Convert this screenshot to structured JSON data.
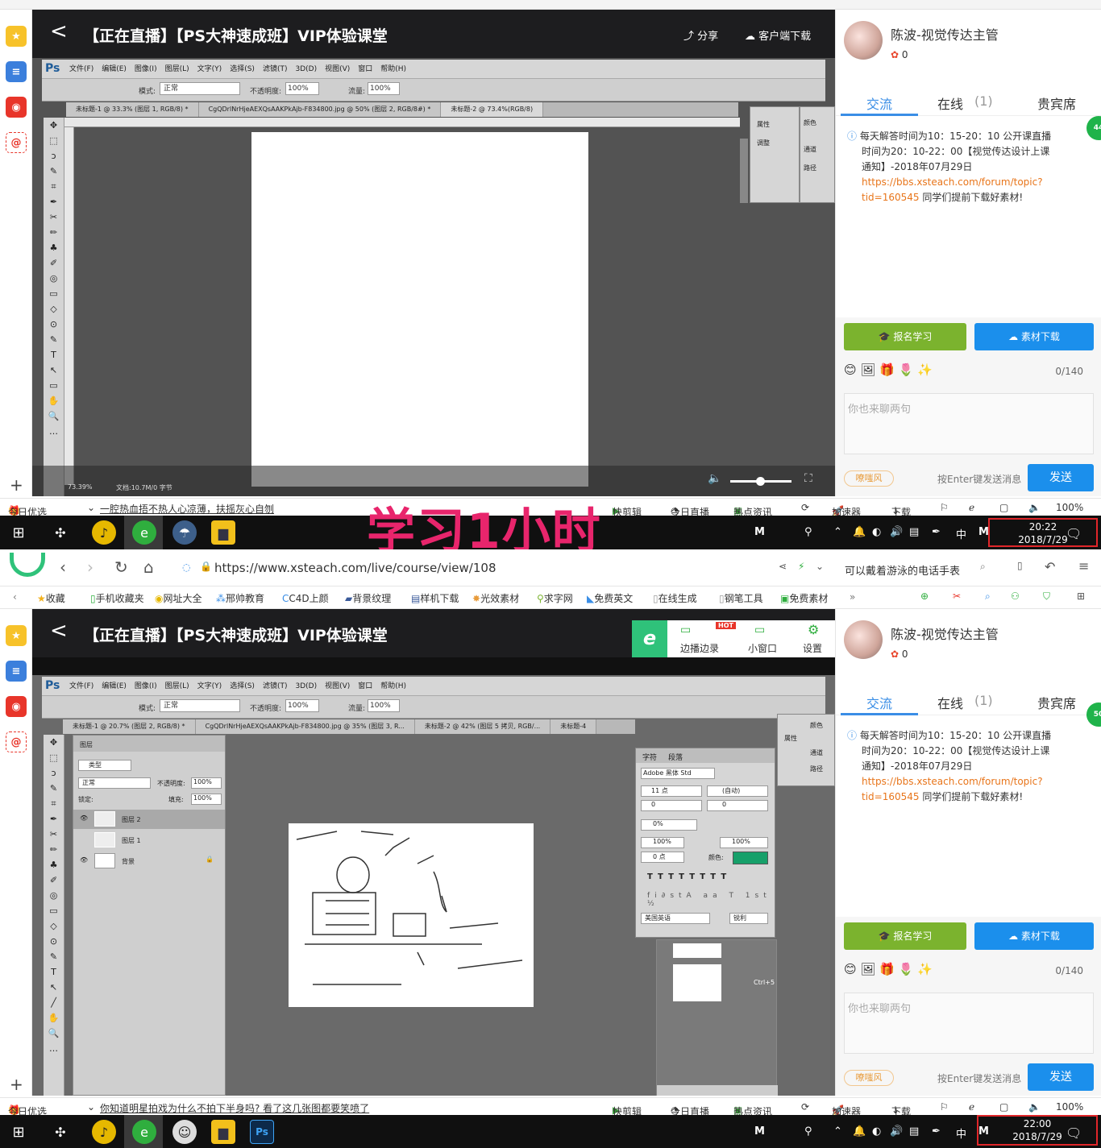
{
  "top": {
    "header": {
      "back": "<",
      "title": "【正在直播】【PS大神速成班】VIP体验课堂",
      "share": "分享",
      "download_client": "客户端下载"
    },
    "ps": {
      "logo": "Ps",
      "menu": [
        "文件(F)",
        "编辑(E)",
        "图像(I)",
        "图层(L)",
        "文字(Y)",
        "选择(S)",
        "滤镜(T)",
        "3D(D)",
        "视图(V)",
        "窗口",
        "帮助(H)"
      ],
      "options": {
        "mode_label": "模式:",
        "mode_value": "正常",
        "opacity_label": "不透明度:",
        "opacity_value": "100%",
        "flow_label": "流量:",
        "flow_value": "100%"
      },
      "tabs": [
        "未标题-1 @ 33.3% (图层 1, RGB/8) *",
        "CgQDrlNrHjeAEXQsAAKPkAjb-F834800.jpg @ 50% (图层 2, RGB/8#) *",
        "未标题-2 @ 73.4%(RGB/8)"
      ],
      "panels": [
        "属性",
        "调整",
        "颜色",
        "通道",
        "路径"
      ],
      "status_zoom": "73.39%",
      "status_doc": "文档:10.7M/0 字节"
    },
    "sidebar": {
      "user": "陈波-视觉传达主管",
      "likes": "0",
      "tabs": [
        "交流",
        "在线",
        "(1)",
        "贵宾席"
      ],
      "notice": {
        "line1": "每天解答时间为10：15-20：10 公开课直播",
        "line2": "时间为20：10-22：00【视觉传达设计上课",
        "line3": "通知】-2018年07月29日",
        "link1": "https://bbs.xsteach.com/forum/topic?",
        "link2": "tid=160545",
        "after": " 同学们提前下载好素材!"
      },
      "enroll": "报名学习",
      "material": "素材下载",
      "counter": "0/140",
      "placeholder": "你也来聊两句",
      "hint": "按Enter键发送消息",
      "send": "发送",
      "badge": "44",
      "tag": "嘹嗤风"
    },
    "strip": {
      "today": "今日优选",
      "news": "一腔热血捂不热人心凉薄，扶摇灰心自刎",
      "kuaijian": "快剪辑",
      "live": "今日直播",
      "hot": "热点资讯",
      "accel": "加速器",
      "dl": "下载",
      "zoom": "100%"
    },
    "clock": {
      "time": "20:22",
      "date": "2018/7/29"
    }
  },
  "caption": "学习1小时",
  "bottom": {
    "browser": {
      "url": "https://www.xsteach.com/live/course/view/108",
      "search": "可以戴着游泳的电话手表"
    },
    "bookmarks": [
      "收藏",
      "手机收藏夹",
      "网址大全",
      "邢帅教育",
      "C4D上颜",
      "背景纹理",
      "样机下载",
      "光效素材",
      "求字网",
      "免费英文",
      "在线生成",
      "钢笔工具",
      "免费素材"
    ],
    "header": {
      "back": "<",
      "title": "【正在直播】【PS大神速成班】VIP体验课堂",
      "record": "边播边录",
      "hot": "HOT",
      "mini": "小窗口",
      "settings": "设置"
    },
    "ps": {
      "logo": "Ps",
      "menu": [
        "文件(F)",
        "编辑(E)",
        "图像(I)",
        "图层(L)",
        "文字(Y)",
        "选择(S)",
        "滤镜(T)",
        "3D(D)",
        "视图(V)",
        "窗口",
        "帮助(H)"
      ],
      "options": {
        "mode_label": "模式:",
        "mode_value": "正常",
        "opacity_label": "不透明度:",
        "opacity_value": "100%",
        "flow_label": "流量:",
        "flow_value": "100%"
      },
      "tabs": [
        "未标题-1 @ 20.7% (图层 2, RGB/8) *",
        "CgQDrlNrHjeAEXQsAAKPkAjb-F834800.jpg @ 35% (图层 3, R...",
        "未标题-2 @ 42% (图层 5 拷贝, RGB/...",
        "未标题-4"
      ],
      "layers": {
        "title": "图层",
        "filter": "类型",
        "blend": "正常",
        "opacity_label": "不透明度:",
        "opacity": "100%",
        "lock": "锁定:",
        "fill_label": "填充:",
        "fill": "100%",
        "items": [
          "图层 2",
          "图层 1",
          "背景"
        ]
      },
      "char": {
        "tabs": [
          "字符",
          "段落"
        ],
        "font": "Adobe 黑体 Std",
        "size": "11 点",
        "leading": "(自动)",
        "tracking": "0",
        "kerning": "0",
        "scale_v": "100%",
        "scale_h": "100%",
        "shift": "0 点",
        "color_label": "颜色:",
        "tsume": "0%",
        "lang": "美国英语",
        "aa": "锐利"
      },
      "shortcut": "Ctrl+5",
      "panels": [
        "属性",
        "颜色",
        "通道",
        "路径"
      ]
    },
    "sidebar": {
      "user": "陈波-视觉传达主管",
      "likes": "0",
      "tabs": [
        "交流",
        "在线",
        "(1)",
        "贵宾席"
      ],
      "notice": {
        "line1": "每天解答时间为10：15-20：10 公开课直播",
        "line2": "时间为20：10-22：00【视觉传达设计上课",
        "line3": "通知】-2018年07月29日",
        "link1": "https://bbs.xsteach.com/forum/topic?",
        "link2": "tid=160545",
        "after": " 同学们提前下载好素材!"
      },
      "enroll": "报名学习",
      "material": "素材下载",
      "counter": "0/140",
      "placeholder": "你也来聊两句",
      "hint": "按Enter键发送消息",
      "send": "发送",
      "badge": "50",
      "tag": "嘹嗤风"
    },
    "strip": {
      "today": "今日优选",
      "news": "你知道明星拍戏为什么不拍下半身吗? 看了这几张图都要笑喷了",
      "kuaijian": "快剪辑",
      "live": "今日直播",
      "hot": "热点资讯",
      "accel": "加速器",
      "dl": "下载",
      "zoom": "100%"
    },
    "clock": {
      "time": "22:00",
      "date": "2018/7/29"
    }
  },
  "taskbar": {
    "ime": "中",
    "m": "M"
  },
  "colors": {
    "green": "#7bb32e",
    "blue": "#1b8fec",
    "tab_blue": "#3a8ee6",
    "link": "#e8751a",
    "caption": "#e8256c",
    "clock_border": "#e0262a"
  }
}
